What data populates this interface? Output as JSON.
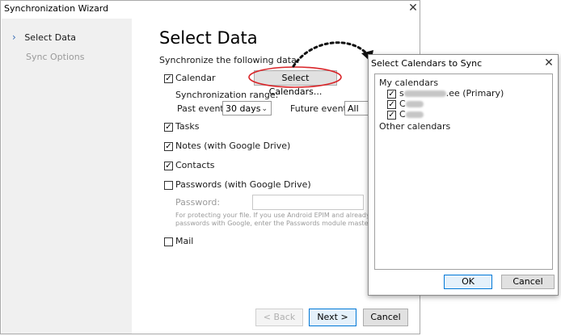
{
  "wizard": {
    "title": "Synchronization Wizard",
    "close_glyph": "✕",
    "sidebar": {
      "items": [
        {
          "label": "Select Data",
          "active": true,
          "chevron": "›"
        },
        {
          "label": "Sync Options",
          "active": false
        }
      ]
    },
    "heading": "Select Data",
    "subtitle": "Synchronize the following data:",
    "calendar": {
      "label": "Calendar",
      "checked": true,
      "select_button": "Select Calendars...",
      "range_label": "Synchronization range:",
      "past_label": "Past events:",
      "past_value": "30 days",
      "future_label": "Future events:",
      "future_value": "All"
    },
    "tasks": {
      "label": "Tasks",
      "checked": true
    },
    "notes": {
      "label": "Notes (with Google Drive)",
      "checked": true
    },
    "contacts": {
      "label": "Contacts",
      "checked": true
    },
    "passwords": {
      "label": "Passwords (with Google Drive)",
      "checked": false,
      "password_label": "Password:",
      "password_value": "",
      "help_line1": "For protecting your file. If you use Android EPIM and already sy",
      "help_line2": "passwords with Google, enter the Passwords module master p"
    },
    "mail": {
      "label": "Mail",
      "checked": false
    },
    "buttons": {
      "back": "< Back",
      "next": "Next >",
      "cancel": "Cancel"
    }
  },
  "dialog": {
    "title": "Select Calendars to Sync",
    "close_glyph": "✕",
    "groups": {
      "my_calendars": "My calendars",
      "other_calendars": "Other calendars"
    },
    "calendars": [
      {
        "visible_prefix": "s",
        "visible_suffix": ".ee (Primary)",
        "checked": true
      },
      {
        "visible_prefix": "C",
        "visible_suffix": "",
        "checked": true
      },
      {
        "visible_prefix": "C",
        "visible_suffix": "",
        "checked": true
      }
    ],
    "buttons": {
      "ok": "OK",
      "cancel": "Cancel"
    }
  },
  "colors": {
    "accent": "#0078d7",
    "annotation_red": "#d9262a",
    "chevron_blue": "#3a6fb7"
  },
  "icons": {
    "checkbox_checked": "✓",
    "dropdown": "⌄"
  }
}
